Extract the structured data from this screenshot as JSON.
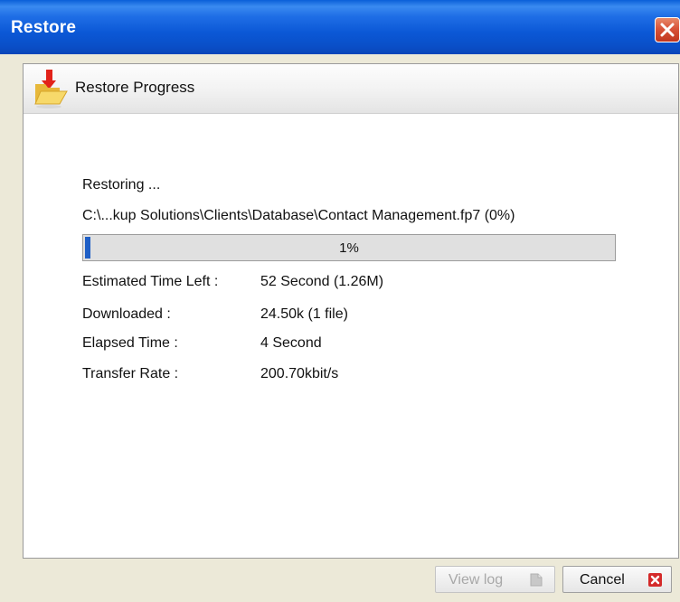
{
  "window": {
    "title": "Restore"
  },
  "panel": {
    "title": "Restore Progress"
  },
  "status": {
    "heading": "Restoring ...",
    "file_path": "C:\\...kup Solutions\\Clients\\Database\\Contact Management.fp7 (0%)"
  },
  "progress": {
    "percent": 1,
    "label": "1%"
  },
  "details": [
    {
      "label": "Estimated Time Left :",
      "value": "52 Second (1.26M)"
    },
    {
      "label": "Downloaded :",
      "value": "24.50k (1 file)"
    },
    {
      "label": "Elapsed Time :",
      "value": "4 Second"
    },
    {
      "label": "Transfer Rate :",
      "value": "200.70kbit/s"
    }
  ],
  "buttons": {
    "view_log": {
      "label": "View log",
      "enabled": false,
      "icon": "document-icon"
    },
    "cancel": {
      "label": "Cancel",
      "enabled": true,
      "icon": "close-icon"
    }
  },
  "colors": {
    "titlebar": "#0b58d6",
    "progress_fill": "#1f5fc6",
    "cancel_icon": "#d42a2a"
  }
}
